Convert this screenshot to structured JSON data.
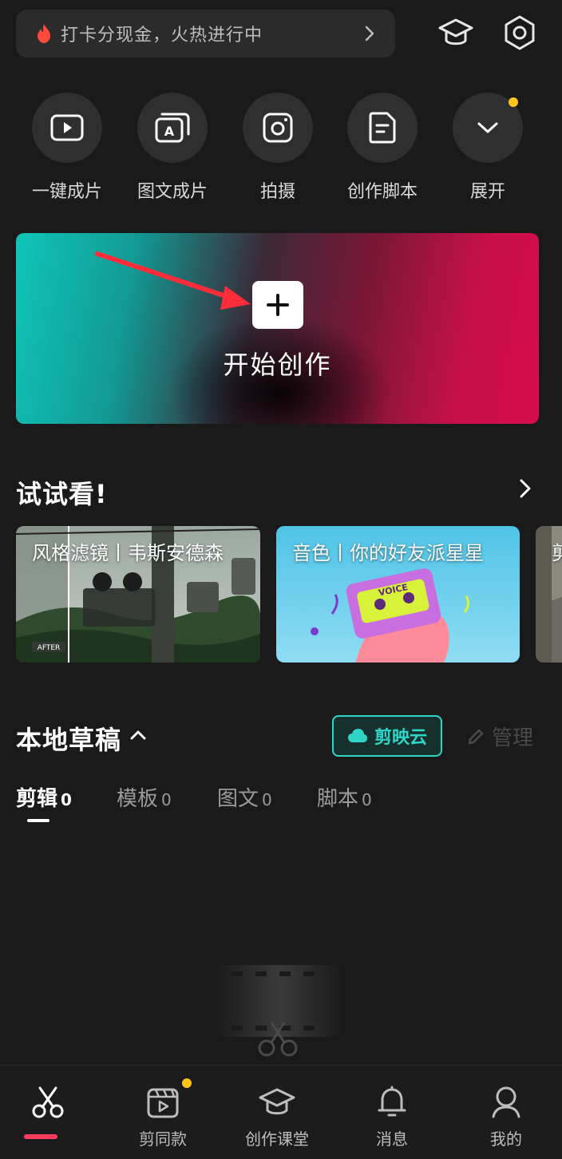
{
  "header": {
    "promo_text": "打卡分现金，火热进行中"
  },
  "quick_actions": [
    {
      "label": "一键成片",
      "icon": "play-square-icon"
    },
    {
      "label": "图文成片",
      "icon": "text-to-video-icon"
    },
    {
      "label": "拍摄",
      "icon": "camera-icon"
    },
    {
      "label": "创作脚本",
      "icon": "script-icon"
    },
    {
      "label": "展开",
      "icon": "chevron-down-icon"
    }
  ],
  "hero": {
    "label": "开始创作"
  },
  "try_section": {
    "title": "试试看!",
    "cards": [
      {
        "title": "风格滤镜丨韦斯安德森",
        "badge": "AFTER"
      },
      {
        "title": "音色丨你的好友派星星",
        "badge": "VOICE"
      },
      {
        "title": "剪"
      }
    ]
  },
  "drafts": {
    "title": "本地草稿",
    "cloud_label": "剪映云",
    "manage_label": "管理",
    "tabs": [
      {
        "label": "剪辑",
        "count": "0"
      },
      {
        "label": "模板",
        "count": "0"
      },
      {
        "label": "图文",
        "count": "0"
      },
      {
        "label": "脚本",
        "count": "0"
      }
    ]
  },
  "bottom_nav": [
    {
      "label": "",
      "icon": "scissors-icon"
    },
    {
      "label": "剪同款",
      "icon": "template-video-icon"
    },
    {
      "label": "创作课堂",
      "icon": "graduation-cap-icon"
    },
    {
      "label": "消息",
      "icon": "bell-icon"
    },
    {
      "label": "我的",
      "icon": "user-icon"
    }
  ],
  "colors": {
    "background": "#1a1a1a",
    "accent_teal": "#2fd6c8",
    "accent_red": "#ff3d5d",
    "notification_dot": "#ffc51c"
  }
}
